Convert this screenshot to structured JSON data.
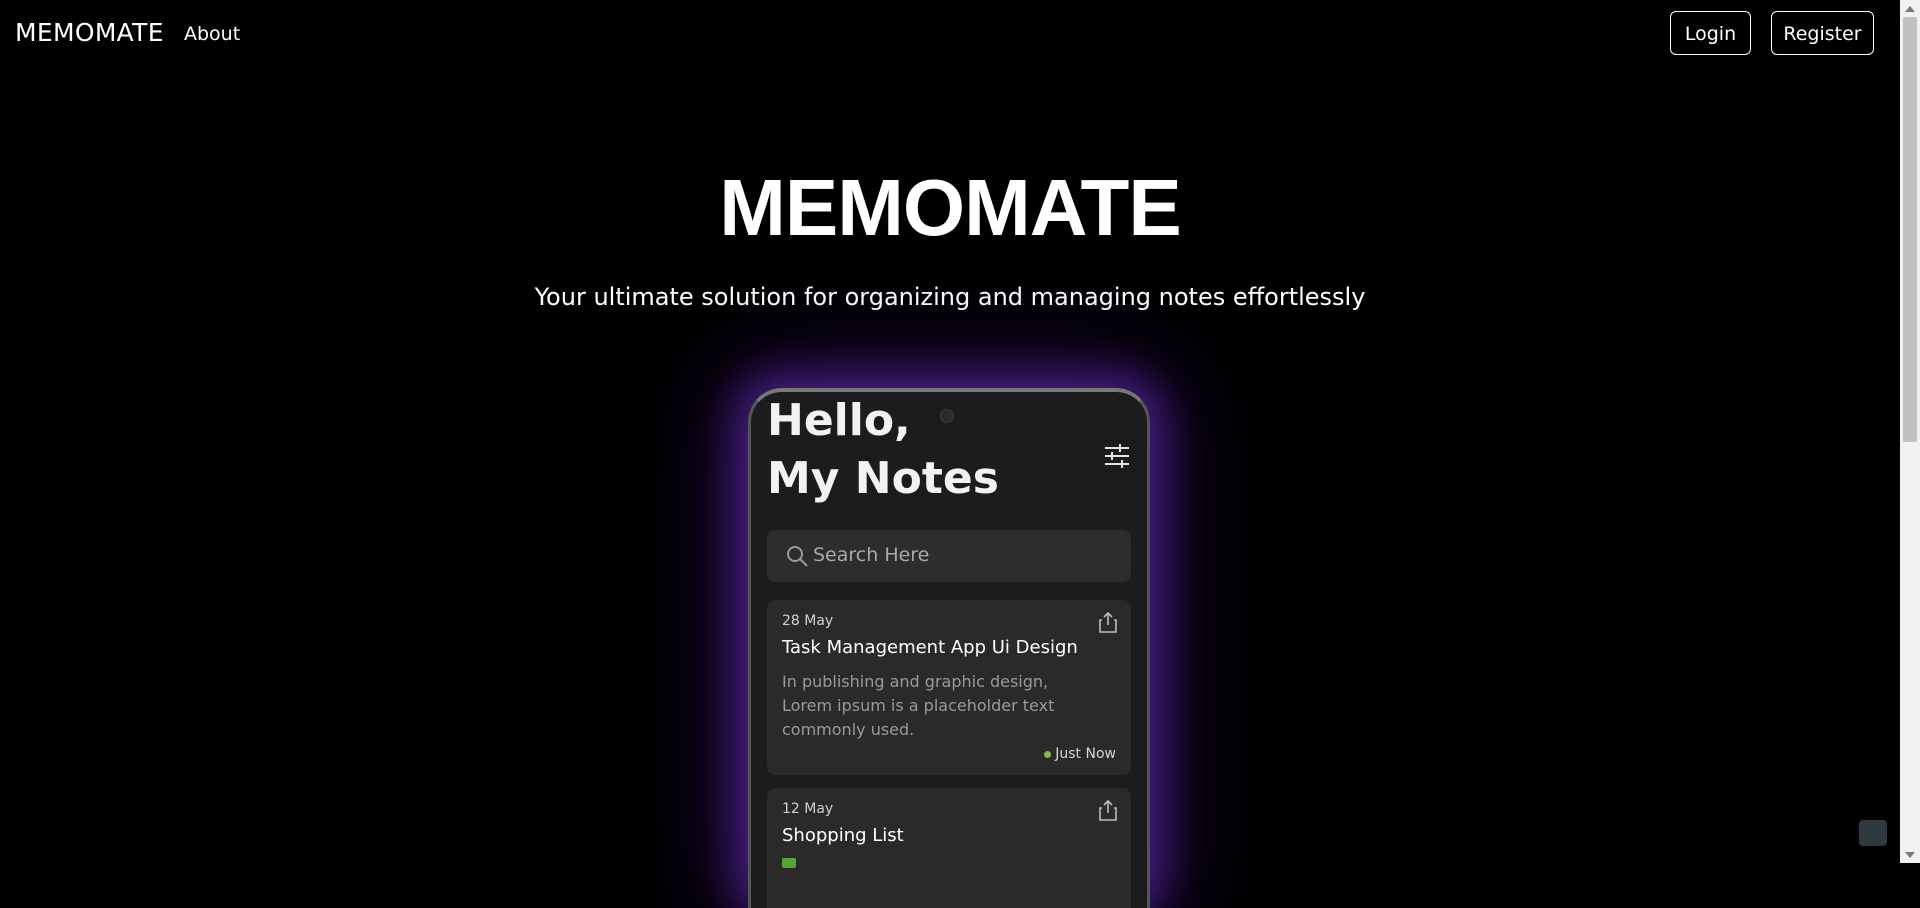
{
  "nav": {
    "brand": "MEMOMATE",
    "about": "About",
    "login": "Login",
    "register": "Register"
  },
  "hero": {
    "title": "MEMOMATE",
    "subtitle": "Your ultimate solution for organizing and managing notes effortlessly"
  },
  "phone": {
    "greeting_line1": "Hello,",
    "greeting_line2": "My Notes",
    "search_placeholder": "Search Here",
    "notes": [
      {
        "date": "28 May",
        "title": "Task Management App Ui Design",
        "body": "In publishing and graphic design, Lorem ipsum is a placeholder text commonly used.",
        "status": "Just Now"
      },
      {
        "date": "12 May",
        "title": "Shopping List"
      }
    ]
  },
  "icons": {
    "filter": "sliders-icon",
    "search": "search-icon",
    "share": "share-icon"
  },
  "colors": {
    "background": "#000000",
    "accent_glow": "#6e32c8",
    "status_dot": "#7bc043"
  }
}
